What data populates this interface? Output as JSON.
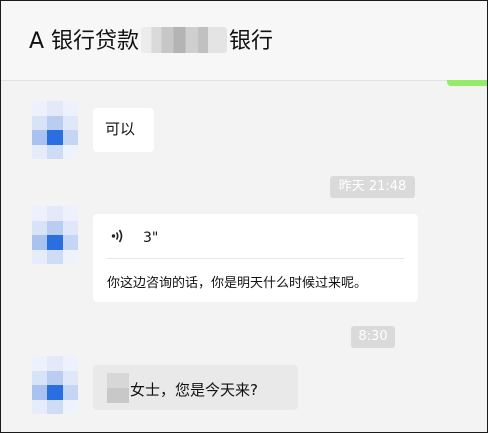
{
  "header": {
    "title_prefix": "A 银行贷款",
    "title_suffix": "银行"
  },
  "messages": [
    {
      "kind": "text",
      "text": "可以"
    },
    {
      "kind": "timestamp",
      "text": "昨天 21:48"
    },
    {
      "kind": "voice",
      "duration": "3\"",
      "transcript": "你这边咨询的话，你是明天什么时候过来呢。",
      "icon": "voice-icon"
    },
    {
      "kind": "timestamp",
      "text": "8:30"
    },
    {
      "kind": "text",
      "text": "女士，您是今天来?"
    }
  ],
  "colors": {
    "accent_green": "#95ec69",
    "avatar_blue": "#2a6fe0",
    "timestamp_bg": "#dadada"
  }
}
